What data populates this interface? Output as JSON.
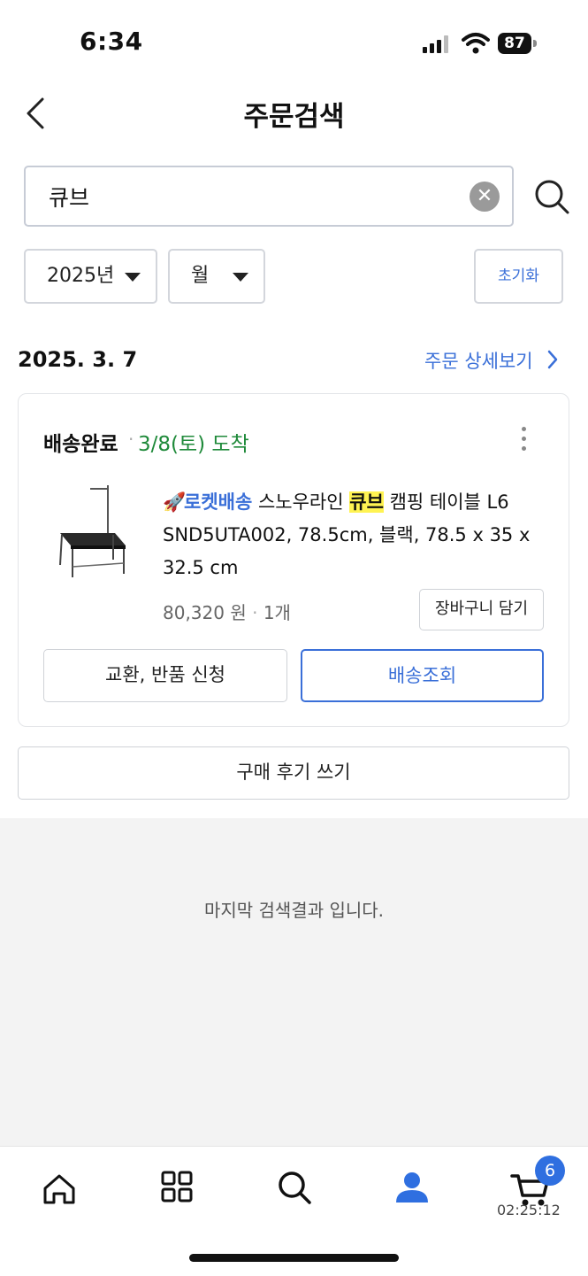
{
  "status_bar": {
    "time": "6:34",
    "battery": "87"
  },
  "header": {
    "title": "주문검색"
  },
  "search": {
    "value": "큐브"
  },
  "filters": {
    "year": "2025년",
    "month": "월",
    "reset_label": "초기화"
  },
  "order": {
    "date": "2025. 3. 7",
    "detail_link": "주문 상세보기",
    "status": "배송완료",
    "separator": "·",
    "arrival": "3/8(토) 도착",
    "product": {
      "badge": "로켓배송",
      "name_before": "스노우라인",
      "highlight": "큐브",
      "name_after": "캠핑 테이블 L6 SND5UTA002, 78.5cm, 블랙, 78.5 x 35 x 32.5 cm",
      "price": "80,320 원",
      "qty": "1개"
    },
    "add_to_cart": "장바구니 담기",
    "return_button": "교환, 반품 신청",
    "track_button": "배송조회",
    "review_button": "구매 후기 쓰기"
  },
  "end_message": "마지막 검색결과 입니다.",
  "bottom_nav": {
    "items": [
      "home-icon",
      "category-icon",
      "search-icon",
      "my-page-icon",
      "cart-icon"
    ],
    "cart_badge": "6",
    "cart_timer": "02:25:12"
  },
  "colors": {
    "accent": "#3a6fd8",
    "arrival": "#1f8a3a",
    "highlight": "#fff352"
  }
}
